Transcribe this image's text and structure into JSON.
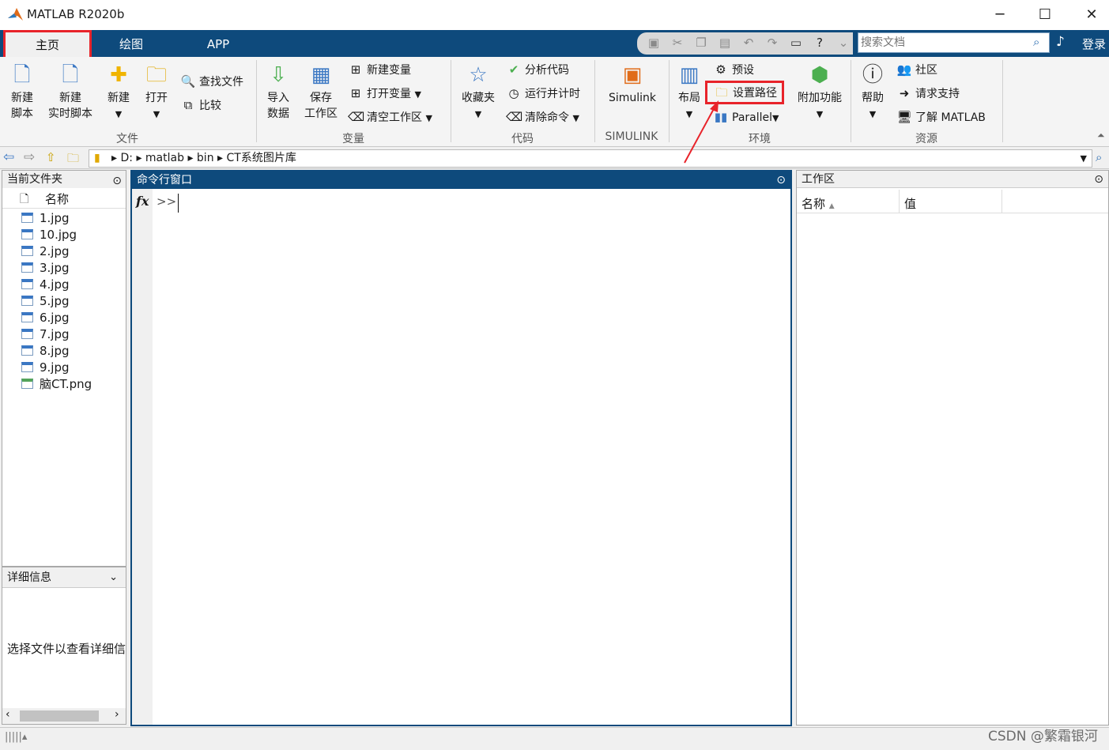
{
  "window": {
    "title": "MATLAB R2020b",
    "minimize": "─",
    "maximize": "☐",
    "close": "✕"
  },
  "tabs": [
    {
      "label": "主页"
    },
    {
      "label": "绘图"
    },
    {
      "label": "APP"
    }
  ],
  "search": {
    "placeholder": "搜索文档",
    "login": "登录"
  },
  "ribbon": {
    "file": {
      "new_script": [
        "新建",
        "脚本"
      ],
      "new_live": [
        "新建",
        "实时脚本"
      ],
      "new": "新建",
      "open": "打开",
      "find_files": "查找文件",
      "compare": "比较",
      "group": "文件"
    },
    "variable": {
      "import": [
        "导入",
        "数据"
      ],
      "save": [
        "保存",
        "工作区"
      ],
      "new_var": "新建变量",
      "open_var": "打开变量",
      "clear_ws": "清空工作区",
      "group": "变量"
    },
    "code": {
      "favorites": "收藏夹",
      "analyze": "分析代码",
      "run_time": "运行并计时",
      "clear_cmd": "清除命令",
      "group": "代码"
    },
    "simulink": {
      "simulink": "Simulink",
      "group": "SIMULINK"
    },
    "env": {
      "layout": "布局",
      "prefs": "预设",
      "set_path": "设置路径",
      "parallel": "Parallel",
      "addons": "附加功能",
      "group": "环境"
    },
    "resources": {
      "help": "帮助",
      "community": "社区",
      "support": "请求支持",
      "learn": "了解 MATLAB",
      "group": "资源"
    }
  },
  "path": {
    "segments": [
      "D:",
      "matlab",
      "bin",
      "CT系统图片库"
    ]
  },
  "current_folder": {
    "title": "当前文件夹",
    "col_name": "名称",
    "files": [
      "1.jpg",
      "10.jpg",
      "2.jpg",
      "3.jpg",
      "4.jpg",
      "5.jpg",
      "6.jpg",
      "7.jpg",
      "8.jpg",
      "9.jpg",
      "脑CT.png"
    ]
  },
  "details": {
    "title": "详细信息",
    "hint": "选择文件以查看详细信"
  },
  "command": {
    "title": "命令行窗口",
    "prompt": ">>"
  },
  "workspace": {
    "title": "工作区",
    "col_name": "名称",
    "col_value": "值"
  },
  "watermark": "CSDN @繁霜银河",
  "accent": {
    "tabbar": "#0e4a7c",
    "highlight": "#e8232a"
  }
}
